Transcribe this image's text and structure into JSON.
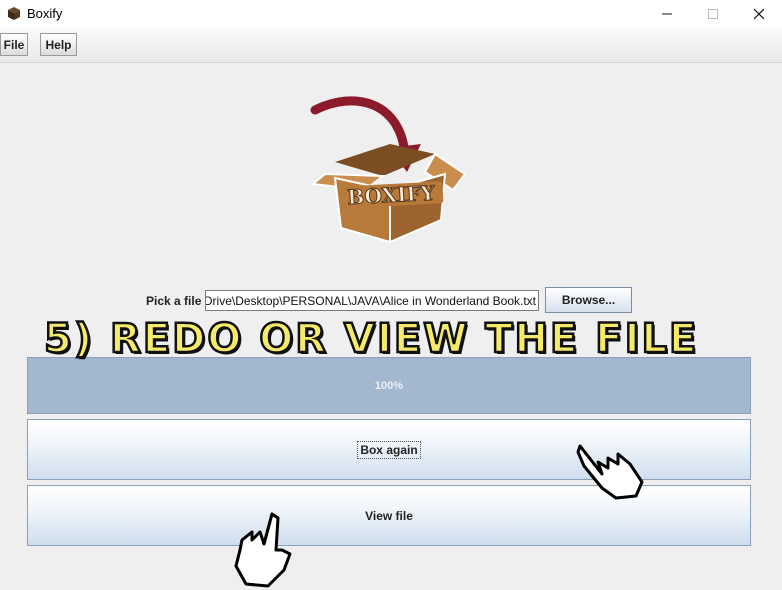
{
  "window": {
    "title": "Boxify"
  },
  "menu": {
    "items": [
      "File",
      "Help"
    ]
  },
  "logo": {
    "text": "BOXIFY"
  },
  "file_picker": {
    "label": "Pick a file",
    "value": "Drive\\Desktop\\PERSONAL\\JAVA\\Alice in Wonderland Book.txt",
    "browse_label": "Browse..."
  },
  "progress": {
    "value": 100,
    "text": "100%"
  },
  "buttons": {
    "box_again": "Box again",
    "view_file": "View file"
  },
  "overlay": {
    "caption": "5) REDO OR VIEW THE FILE"
  },
  "colors": {
    "progress": "#a3b7cf",
    "overlay_text": "#f5ea6a",
    "box": "#b87a3a",
    "arrow": "#8b1a2b"
  }
}
